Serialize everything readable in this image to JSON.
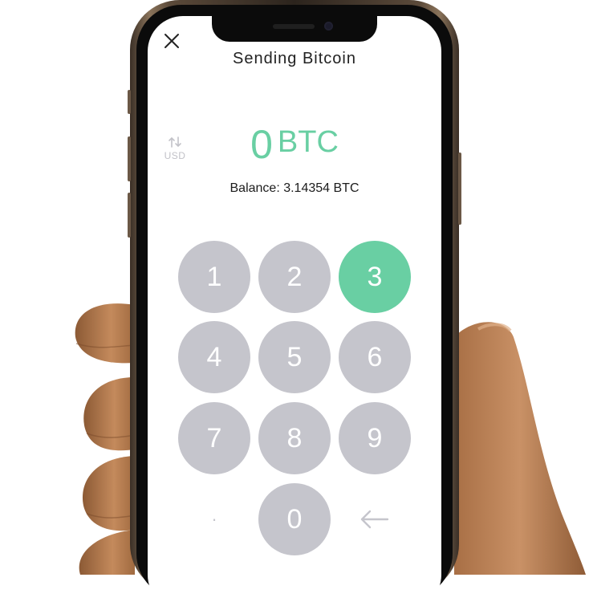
{
  "screen": {
    "title": "Sending Bitcoin",
    "amount": {
      "value": "0",
      "unit": "BTC",
      "color": "#69cfa3"
    },
    "currency_toggle": {
      "icon": "swap-vertical-icon",
      "label": "USD"
    },
    "balance_text": "Balance: 3.14354 BTC",
    "close_icon": "close-icon"
  },
  "keypad": {
    "keys": [
      "1",
      "2",
      "3",
      "4",
      "5",
      "6",
      "7",
      "8",
      "9",
      "·",
      "0"
    ],
    "active_key": "3",
    "backspace_icon": "backspace-arrow-icon",
    "key_color": "#c5c5cc",
    "active_color": "#69cfa3"
  }
}
